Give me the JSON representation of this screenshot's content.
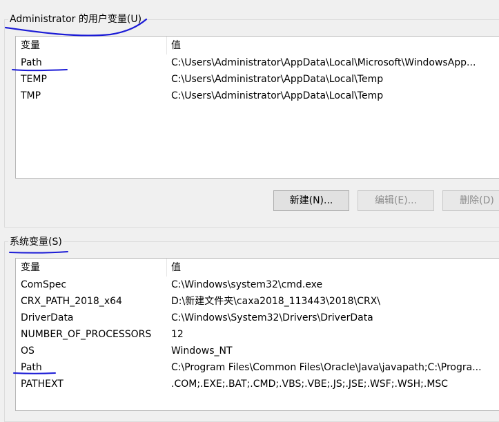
{
  "user_vars": {
    "title": "Administrator 的用户变量(U)",
    "columns": [
      "变量",
      "值"
    ],
    "rows": [
      {
        "name": "Path",
        "value": "C:\\Users\\Administrator\\AppData\\Local\\Microsoft\\WindowsApp..."
      },
      {
        "name": "TEMP",
        "value": "C:\\Users\\Administrator\\AppData\\Local\\Temp"
      },
      {
        "name": "TMP",
        "value": "C:\\Users\\Administrator\\AppData\\Local\\Temp"
      }
    ],
    "buttons": {
      "new": "新建(N)...",
      "edit": "编辑(E)...",
      "delete": "删除(D)"
    }
  },
  "system_vars": {
    "title": "系统变量(S)",
    "columns": [
      "变量",
      "值"
    ],
    "rows": [
      {
        "name": "ComSpec",
        "value": "C:\\Windows\\system32\\cmd.exe"
      },
      {
        "name": "CRX_PATH_2018_x64",
        "value": "D:\\新建文件夹\\caxa2018_113443\\2018\\CRX\\"
      },
      {
        "name": "DriverData",
        "value": "C:\\Windows\\System32\\Drivers\\DriverData"
      },
      {
        "name": "NUMBER_OF_PROCESSORS",
        "value": "12"
      },
      {
        "name": "OS",
        "value": "Windows_NT"
      },
      {
        "name": "Path",
        "value": "C:\\Program Files\\Common Files\\Oracle\\Java\\javapath;C:\\Progra..."
      },
      {
        "name": "PATHEXT",
        "value": ".COM;.EXE;.BAT;.CMD;.VBS;.VBE;.JS;.JSE;.WSF;.WSH;.MSC"
      }
    ]
  },
  "colors": {
    "annotation_ink": "#1a1ad6"
  }
}
